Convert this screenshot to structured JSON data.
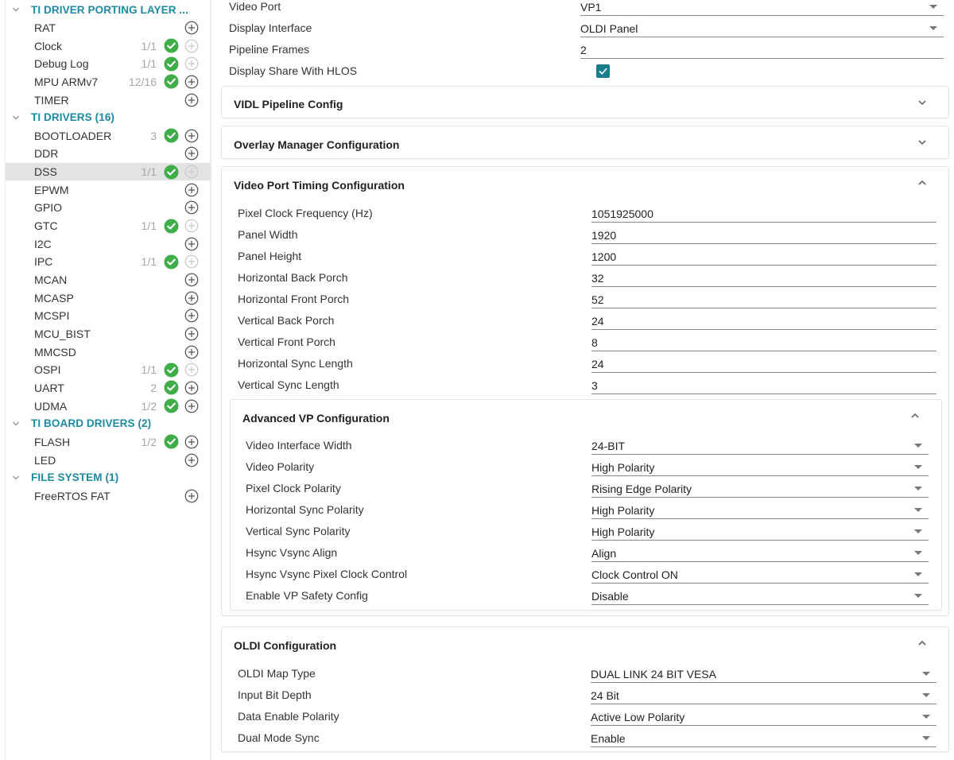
{
  "sidebar": {
    "groups": [
      {
        "title": "TI DRIVER PORTING LAYER ...",
        "items": [
          {
            "name": "RAT",
            "count": "",
            "ok": false,
            "add_enabled": true
          },
          {
            "name": "Clock",
            "count": "1/1",
            "ok": true,
            "add_enabled": false
          },
          {
            "name": "Debug Log",
            "count": "1/1",
            "ok": true,
            "add_enabled": false
          },
          {
            "name": "MPU ARMv7",
            "count": "12/16",
            "ok": true,
            "add_enabled": true
          },
          {
            "name": "TIMER",
            "count": "",
            "ok": false,
            "add_enabled": true
          }
        ]
      },
      {
        "title": "TI DRIVERS (16)",
        "items": [
          {
            "name": "BOOTLOADER",
            "count": "3",
            "ok": true,
            "add_enabled": true
          },
          {
            "name": "DDR",
            "count": "",
            "ok": false,
            "add_enabled": true
          },
          {
            "name": "DSS",
            "count": "1/1",
            "ok": true,
            "add_enabled": false,
            "selected": true
          },
          {
            "name": "EPWM",
            "count": "",
            "ok": false,
            "add_enabled": true
          },
          {
            "name": "GPIO",
            "count": "",
            "ok": false,
            "add_enabled": true
          },
          {
            "name": "GTC",
            "count": "1/1",
            "ok": true,
            "add_enabled": false
          },
          {
            "name": "I2C",
            "count": "",
            "ok": false,
            "add_enabled": true
          },
          {
            "name": "IPC",
            "count": "1/1",
            "ok": true,
            "add_enabled": false
          },
          {
            "name": "MCAN",
            "count": "",
            "ok": false,
            "add_enabled": true
          },
          {
            "name": "MCASP",
            "count": "",
            "ok": false,
            "add_enabled": true
          },
          {
            "name": "MCSPI",
            "count": "",
            "ok": false,
            "add_enabled": true
          },
          {
            "name": "MCU_BIST",
            "count": "",
            "ok": false,
            "add_enabled": true
          },
          {
            "name": "MMCSD",
            "count": "",
            "ok": false,
            "add_enabled": true
          },
          {
            "name": "OSPI",
            "count": "1/1",
            "ok": true,
            "add_enabled": false
          },
          {
            "name": "UART",
            "count": "2",
            "ok": true,
            "add_enabled": true
          },
          {
            "name": "UDMA",
            "count": "1/2",
            "ok": true,
            "add_enabled": true
          }
        ]
      },
      {
        "title": "TI BOARD DRIVERS (2)",
        "items": [
          {
            "name": "FLASH",
            "count": "1/2",
            "ok": true,
            "add_enabled": true
          },
          {
            "name": "LED",
            "count": "",
            "ok": false,
            "add_enabled": true
          }
        ]
      },
      {
        "title": "FILE SYSTEM (1)",
        "items": [
          {
            "name": "FreeRTOS FAT",
            "count": "",
            "ok": false,
            "add_enabled": true
          }
        ]
      }
    ]
  },
  "main": {
    "top_fields": [
      {
        "label": "Video Port",
        "value": "VP1",
        "type": "select"
      },
      {
        "label": "Display Interface",
        "value": "OLDI Panel",
        "type": "select"
      },
      {
        "label": "Pipeline Frames",
        "value": "2",
        "type": "text"
      },
      {
        "label": "Display Share With HLOS",
        "checked": true,
        "type": "checkbox"
      }
    ],
    "collapsed_panels": [
      {
        "title": "VIDL Pipeline Config",
        "expanded": false
      },
      {
        "title": "Overlay Manager Configuration",
        "expanded": false
      }
    ],
    "timing_panel": {
      "title": "Video Port Timing Configuration",
      "expanded": true,
      "fields": [
        {
          "label": "Pixel Clock Frequency (Hz)",
          "value": "1051925000"
        },
        {
          "label": "Panel Width",
          "value": "1920"
        },
        {
          "label": "Panel Height",
          "value": "1200"
        },
        {
          "label": "Horizontal Back Porch",
          "value": "32"
        },
        {
          "label": "Horizontal Front Porch",
          "value": "52"
        },
        {
          "label": "Vertical Back Porch",
          "value": "24"
        },
        {
          "label": "Vertical Front Porch",
          "value": "8"
        },
        {
          "label": "Horizontal Sync Length",
          "value": "24"
        },
        {
          "label": "Vertical Sync Length",
          "value": "3"
        }
      ],
      "advanced": {
        "title": "Advanced VP Configuration",
        "expanded": true,
        "fields": [
          {
            "label": "Video Interface Width",
            "value": "24-BIT"
          },
          {
            "label": "Video Polarity",
            "value": "High Polarity"
          },
          {
            "label": "Pixel Clock Polarity",
            "value": "Rising Edge Polarity"
          },
          {
            "label": "Horizontal Sync Polarity",
            "value": "High Polarity"
          },
          {
            "label": "Vertical Sync Polarity",
            "value": "High Polarity"
          },
          {
            "label": "Hsync Vsync Align",
            "value": "Align"
          },
          {
            "label": "Hsync Vsync Pixel Clock Control",
            "value": "Clock Control ON"
          },
          {
            "label": "Enable VP Safety Config",
            "value": "Disable"
          }
        ]
      }
    },
    "oldi_panel": {
      "title": "OLDI Configuration",
      "expanded": true,
      "fields": [
        {
          "label": "OLDI Map Type",
          "value": "DUAL LINK 24 BIT VESA"
        },
        {
          "label": "Input Bit Depth",
          "value": "24 Bit"
        },
        {
          "label": "Data Enable Polarity",
          "value": "Active Low Polarity"
        },
        {
          "label": "Dual Mode Sync",
          "value": "Enable"
        }
      ]
    }
  },
  "colors": {
    "accent": "#1b8aa0",
    "ok_green": "#3fae49",
    "checkbox": "#177e8c",
    "selected_bg": "#e3e3e3"
  }
}
